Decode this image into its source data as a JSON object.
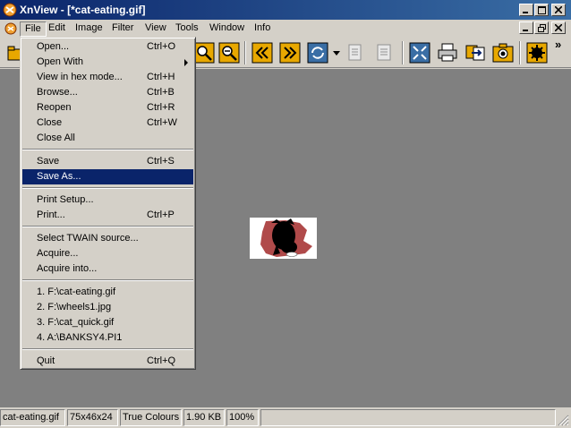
{
  "window": {
    "title": "XnView - [*cat-eating.gif]",
    "controls": [
      "minimize",
      "maximize",
      "close"
    ],
    "mdi_controls": [
      "minimize",
      "restore",
      "close"
    ]
  },
  "menubar": {
    "items": [
      "File",
      "Edit",
      "Image",
      "Filter",
      "View",
      "Tools",
      "Window",
      "Info"
    ],
    "open_menu": "File"
  },
  "file_menu": {
    "groups": [
      [
        {
          "label": "Open...",
          "shortcut": "Ctrl+O"
        },
        {
          "label": "Open With",
          "shortcut": "",
          "submenu": true
        },
        {
          "label": "View in hex mode...",
          "shortcut": "Ctrl+H"
        },
        {
          "label": "Browse...",
          "shortcut": "Ctrl+B"
        },
        {
          "label": "Reopen",
          "shortcut": "Ctrl+R"
        },
        {
          "label": "Close",
          "shortcut": "Ctrl+W"
        },
        {
          "label": "Close All",
          "shortcut": ""
        }
      ],
      [
        {
          "label": "Save",
          "shortcut": "Ctrl+S"
        },
        {
          "label": "Save As...",
          "shortcut": "",
          "highlighted": true
        }
      ],
      [
        {
          "label": "Print Setup...",
          "shortcut": ""
        },
        {
          "label": "Print...",
          "shortcut": "Ctrl+P"
        }
      ],
      [
        {
          "label": "Select TWAIN source...",
          "shortcut": ""
        },
        {
          "label": "Acquire...",
          "shortcut": ""
        },
        {
          "label": "Acquire into...",
          "shortcut": ""
        }
      ],
      [
        {
          "label": "1. F:\\cat-eating.gif",
          "shortcut": ""
        },
        {
          "label": "2. F:\\wheels1.jpg",
          "shortcut": ""
        },
        {
          "label": "3. F:\\cat_quick.gif",
          "shortcut": ""
        },
        {
          "label": "4. A:\\BANKSY4.PI1",
          "shortcut": ""
        }
      ],
      [
        {
          "label": "Quit",
          "shortcut": "Ctrl+Q"
        }
      ]
    ]
  },
  "toolbar": {
    "buttons": [
      "open-icon",
      "zoom-in-icon",
      "zoom-out-icon",
      "previous-icon",
      "next-icon",
      "refresh-icon",
      "dropdown-arrow-icon",
      "copy-icon",
      "paste-icon",
      "fullscreen-icon",
      "print-icon",
      "convert-icon",
      "capture-icon",
      "settings-icon"
    ],
    "overflow": "»"
  },
  "statusbar": {
    "filename": "cat-eating.gif",
    "dimensions": "75x46x24",
    "colours": "True Colours",
    "size": "1.90 KB",
    "zoom": "100%"
  },
  "colors": {
    "titlebar_start": "#0a246a",
    "titlebar_end": "#3a6ea5",
    "canvas_bg": "#808080",
    "highlight": "#0a246a",
    "image_blob": "#b04a4a",
    "toolbar_icon": "#e8a800"
  }
}
